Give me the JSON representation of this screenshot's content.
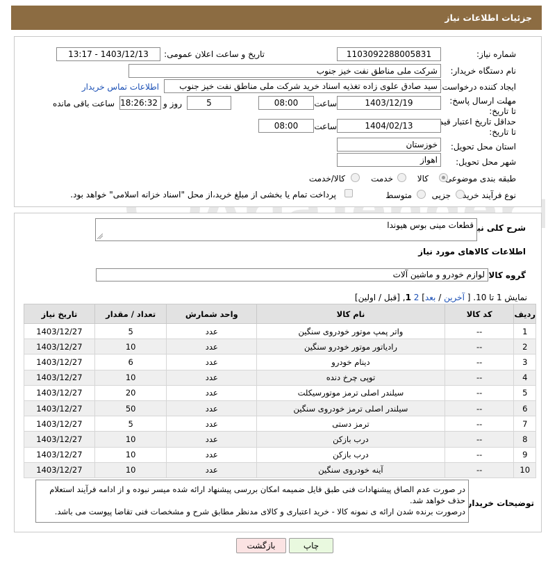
{
  "page": {
    "title": "جزئیات اطلاعات نیاز"
  },
  "watermark": {
    "text": "AriaTender.neT"
  },
  "need_number": {
    "label": "شماره نیاز:",
    "value": "1103092288005831"
  },
  "announce_date": {
    "label": "تاریخ و ساعت اعلان عمومی:",
    "value": "1403/12/13 - 13:17"
  },
  "buyer_org": {
    "label": "نام دستگاه خریدار:",
    "value": "شرکت ملی مناطق نفت خیز جنوب"
  },
  "requester": {
    "label": "ایجاد کننده درخواست:",
    "value": "سید صادق علوی زاده  تغذیه اسناد خرید  شرکت ملی مناطق نفت خیز جنوب",
    "contact_link": "اطلاعات تماس خریدار"
  },
  "deadline": {
    "label": "مهلت ارسال پاسخ: تا تاریخ:",
    "date": "1403/12/19",
    "time_label": "ساعت",
    "time": "08:00",
    "days": "5",
    "days_label": "روز و",
    "remaining": "18:26:32",
    "remaining_label": "ساعت باقی مانده"
  },
  "price_validity": {
    "label": "حداقل تاریخ اعتبار قیمت: تا تاریخ:",
    "date": "1404/02/13",
    "time_label": "ساعت",
    "time": "08:00"
  },
  "province": {
    "label": "استان محل تحویل:",
    "value": "خوزستان"
  },
  "city": {
    "label": "شهر محل تحویل:",
    "value": "اهواز"
  },
  "category": {
    "label": "طبقه بندی موضوعی:",
    "options": [
      "کالا",
      "خدمت",
      "کالا/خدمت"
    ],
    "selected": "کالا"
  },
  "process": {
    "label": "نوع فرآیند خرید :",
    "options": [
      "جزیی",
      "متوسط"
    ],
    "payment_note": "پرداخت تمام یا بخشی از مبلغ خرید،از محل \"اسناد خزانه اسلامی\" خواهد بود."
  },
  "description": {
    "label": "شرح کلی نیاز:",
    "value": "قطعات مینی بوس هیوندا"
  },
  "goods_info": {
    "heading": "اطلاعات کالاهای مورد نیاز"
  },
  "goods_group": {
    "label": "گروه کالا:",
    "value": "لوازم خودرو و ماشین آلات"
  },
  "pagination": {
    "show": "نمایش 1 تا 10. [",
    "last": "آخرین",
    "sep1": "/",
    "next": "بعد",
    "pages_pre": "]",
    "page2": "2",
    "page1": "1",
    "pages_post": ", [قبل / اولین]"
  },
  "table": {
    "headers": {
      "row": "ردیف",
      "code": "کد کالا",
      "name": "نام کالا",
      "unit": "واحد شمارش",
      "qty": "تعداد / مقدار",
      "date": "تاریخ نیاز"
    },
    "rows": [
      {
        "row": "1",
        "code": "--",
        "name": "واتر پمپ موتور خودروی سنگین",
        "unit": "عدد",
        "qty": "5",
        "date": "1403/12/27"
      },
      {
        "row": "2",
        "code": "--",
        "name": "رادیاتور موتور خودرو سنگین",
        "unit": "عدد",
        "qty": "10",
        "date": "1403/12/27"
      },
      {
        "row": "3",
        "code": "--",
        "name": "دینام خودرو",
        "unit": "عدد",
        "qty": "6",
        "date": "1403/12/27"
      },
      {
        "row": "4",
        "code": "--",
        "name": "توپی چرخ دنده",
        "unit": "عدد",
        "qty": "10",
        "date": "1403/12/27"
      },
      {
        "row": "5",
        "code": "--",
        "name": "سیلندر اصلی ترمز موتورسیکلت",
        "unit": "عدد",
        "qty": "20",
        "date": "1403/12/27"
      },
      {
        "row": "6",
        "code": "--",
        "name": "سیلندر اصلی ترمز خودروی سنگین",
        "unit": "عدد",
        "qty": "50",
        "date": "1403/12/27"
      },
      {
        "row": "7",
        "code": "--",
        "name": "ترمز دستی",
        "unit": "عدد",
        "qty": "5",
        "date": "1403/12/27"
      },
      {
        "row": "8",
        "code": "--",
        "name": "درب بازکن",
        "unit": "عدد",
        "qty": "10",
        "date": "1403/12/27"
      },
      {
        "row": "9",
        "code": "--",
        "name": "درب بازکن",
        "unit": "عدد",
        "qty": "10",
        "date": "1403/12/27"
      },
      {
        "row": "10",
        "code": "--",
        "name": "آینه خودروی سنگین",
        "unit": "عدد",
        "qty": "10",
        "date": "1403/12/27"
      }
    ]
  },
  "buyer_notes": {
    "label": "توضیحات خریدار:",
    "value": "در صورت عدم الصاق پیشنهادات فنی طبق فایل ضمیمه امکان بررسی پیشنهاد ارائه شده میسر نبوده و از ادامه فرآیند استعلام حذف خواهد شد.\nدرصورت برنده شدن ارائه ی نمونه کالا - خرید اعتباری و کالای مدنظر مطابق شرح و مشخصات فنی تقاضا پیوست می باشد."
  },
  "buttons": {
    "print": "چاپ",
    "back": "بازگشت"
  },
  "colors": {
    "title_bar": "#8c6c42",
    "link": "#1a4fb5",
    "print_bg": "#e9f9df",
    "back_bg": "#fbe3e3"
  }
}
